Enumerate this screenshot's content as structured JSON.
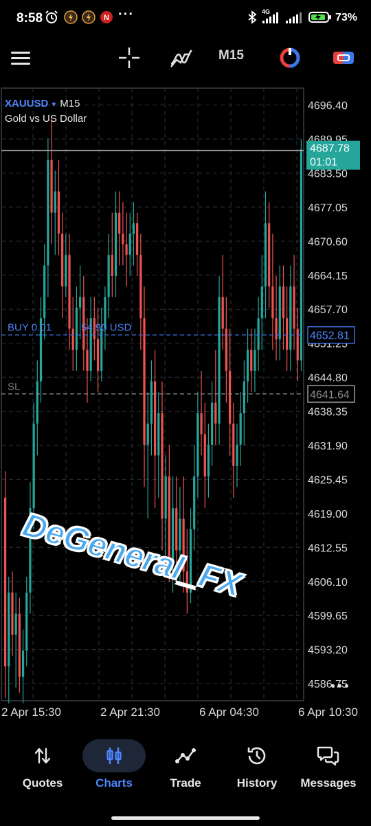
{
  "status_bar": {
    "time": "8:58",
    "dots": "···",
    "network": "4G",
    "battery_percent": "73%",
    "icons": [
      "alarm-icon",
      "app-notification-icon",
      "app-notification-icon",
      "app-notification-icon",
      "bluetooth-icon",
      "signal-icon",
      "signal-icon",
      "battery-charging-icon"
    ]
  },
  "toolbar": {
    "timeframe": "M15",
    "icons": [
      "menu-icon",
      "crosshair-icon",
      "indicators-icon",
      "one-click-trading-icon",
      "trade-icon"
    ]
  },
  "chart": {
    "symbol": "XAUUSD",
    "timeframe": "M15",
    "description": "Gold vs US Dollar",
    "buy_line_label": "BUY 0.01",
    "buy_line_profit": "54.90 USD",
    "buy_price": "4652.81",
    "sl_label": "SL",
    "sl_price": "4641.64",
    "bid_price": "4687.78",
    "bar_countdown": "01:01",
    "watermark": "DeGeneral_FX",
    "colors": {
      "bull": "#26a69a",
      "bear": "#ef5350",
      "buy_line": "#3d6fe0",
      "sl_line": "#8a8a8a",
      "bid_line": "#9e9e9e",
      "grid": "#2d3238"
    }
  },
  "chart_data": {
    "type": "candlestick",
    "symbol": "XAUUSD",
    "timeframe": "M15",
    "ylim": [
      4583.5,
      4699.6
    ],
    "y_ticks": [
      "4696.40",
      "4689.95",
      "4683.50",
      "4677.05",
      "4670.60",
      "4664.15",
      "4657.70",
      "4651.25",
      "4644.80",
      "4638.35",
      "4631.90",
      "4625.45",
      "4619.00",
      "4612.55",
      "4606.10",
      "4599.65",
      "4593.20",
      "4586.75"
    ],
    "x_ticks": [
      "2 Apr 15:30",
      "2 Apr 21:30",
      "6 Apr 04:30",
      "6 Apr 10:30"
    ],
    "ohlc": [
      [
        4622,
        4627,
        4584,
        4590
      ],
      [
        4590,
        4607,
        4583,
        4604
      ],
      [
        4604,
        4608,
        4592,
        4596
      ],
      [
        4596,
        4604,
        4586,
        4600
      ],
      [
        4600,
        4603,
        4585,
        4588
      ],
      [
        4588,
        4597,
        4583,
        4593
      ],
      [
        4593,
        4607,
        4590,
        4604
      ],
      [
        4604,
        4625,
        4600,
        4620
      ],
      [
        4620,
        4640,
        4616,
        4636
      ],
      [
        4636,
        4648,
        4630,
        4644
      ],
      [
        4644,
        4660,
        4640,
        4656
      ],
      [
        4656,
        4670,
        4652,
        4666
      ],
      [
        4666,
        4690,
        4660,
        4686
      ],
      [
        4686,
        4694,
        4670,
        4676
      ],
      [
        4676,
        4684,
        4668,
        4680
      ],
      [
        4680,
        4686,
        4668,
        4672
      ],
      [
        4672,
        4676,
        4656,
        4662
      ],
      [
        4662,
        4672,
        4660,
        4668
      ],
      [
        4668,
        4672,
        4650,
        4654
      ],
      [
        4654,
        4660,
        4646,
        4650
      ],
      [
        4650,
        4662,
        4646,
        4658
      ],
      [
        4658,
        4666,
        4652,
        4660
      ],
      [
        4660,
        4664,
        4646,
        4650
      ],
      [
        4650,
        4656,
        4640,
        4646
      ],
      [
        4646,
        4660,
        4644,
        4656
      ],
      [
        4656,
        4660,
        4648,
        4652
      ],
      [
        4652,
        4658,
        4642,
        4646
      ],
      [
        4646,
        4658,
        4644,
        4654
      ],
      [
        4654,
        4662,
        4650,
        4660
      ],
      [
        4660,
        4672,
        4656,
        4668
      ],
      [
        4668,
        4676,
        4660,
        4664
      ],
      [
        4664,
        4680,
        4660,
        4676
      ],
      [
        4676,
        4680,
        4666,
        4672
      ],
      [
        4672,
        4678,
        4666,
        4670
      ],
      [
        4670,
        4676,
        4662,
        4668
      ],
      [
        4668,
        4676,
        4664,
        4672
      ],
      [
        4672,
        4678,
        4666,
        4674
      ],
      [
        4674,
        4676,
        4664,
        4668
      ],
      [
        4668,
        4672,
        4650,
        4656
      ],
      [
        4656,
        4662,
        4624,
        4632
      ],
      [
        4632,
        4642,
        4618,
        4636
      ],
      [
        4636,
        4648,
        4630,
        4644
      ],
      [
        4644,
        4650,
        4620,
        4630
      ],
      [
        4630,
        4642,
        4622,
        4638
      ],
      [
        4638,
        4644,
        4612,
        4618
      ],
      [
        4618,
        4630,
        4610,
        4626
      ],
      [
        4626,
        4632,
        4606,
        4610
      ],
      [
        4610,
        4626,
        4604,
        4620
      ],
      [
        4620,
        4626,
        4606,
        4612
      ],
      [
        4612,
        4624,
        4606,
        4618
      ],
      [
        4618,
        4626,
        4604,
        4608
      ],
      [
        4608,
        4616,
        4600,
        4604
      ],
      [
        4604,
        4620,
        4602,
        4616
      ],
      [
        4616,
        4632,
        4612,
        4626
      ],
      [
        4626,
        4642,
        4622,
        4638
      ],
      [
        4638,
        4646,
        4630,
        4634
      ],
      [
        4634,
        4640,
        4620,
        4626
      ],
      [
        4626,
        4636,
        4622,
        4632
      ],
      [
        4632,
        4644,
        4628,
        4640
      ],
      [
        4640,
        4650,
        4632,
        4636
      ],
      [
        4636,
        4664,
        4632,
        4660
      ],
      [
        4660,
        4668,
        4650,
        4654
      ],
      [
        4654,
        4660,
        4640,
        4646
      ],
      [
        4646,
        4654,
        4630,
        4636
      ],
      [
        4636,
        4640,
        4622,
        4628
      ],
      [
        4628,
        4636,
        4624,
        4632
      ],
      [
        4632,
        4642,
        4628,
        4638
      ],
      [
        4638,
        4648,
        4632,
        4644
      ],
      [
        4644,
        4654,
        4640,
        4650
      ],
      [
        4650,
        4654,
        4642,
        4646
      ],
      [
        4646,
        4654,
        4642,
        4650
      ],
      [
        4650,
        4660,
        4646,
        4656
      ],
      [
        4656,
        4668,
        4650,
        4662
      ],
      [
        4662,
        4680,
        4656,
        4674
      ],
      [
        4674,
        4678,
        4658,
        4662
      ],
      [
        4662,
        4672,
        4650,
        4656
      ],
      [
        4656,
        4664,
        4648,
        4652
      ],
      [
        4652,
        4666,
        4648,
        4662
      ],
      [
        4662,
        4666,
        4650,
        4656
      ],
      [
        4656,
        4662,
        4646,
        4650
      ],
      [
        4650,
        4666,
        4646,
        4662
      ],
      [
        4662,
        4668,
        4650,
        4654
      ],
      [
        4654,
        4658,
        4644,
        4648
      ],
      [
        4648,
        4690,
        4646,
        4688
      ]
    ]
  },
  "nav": {
    "items": [
      {
        "label": "Quotes",
        "icon": "sort-arrows-icon"
      },
      {
        "label": "Charts",
        "icon": "candlestick-icon"
      },
      {
        "label": "Trade",
        "icon": "trend-line-icon"
      },
      {
        "label": "History",
        "icon": "history-icon"
      },
      {
        "label": "Messages",
        "icon": "messages-icon"
      }
    ],
    "active": 1
  }
}
